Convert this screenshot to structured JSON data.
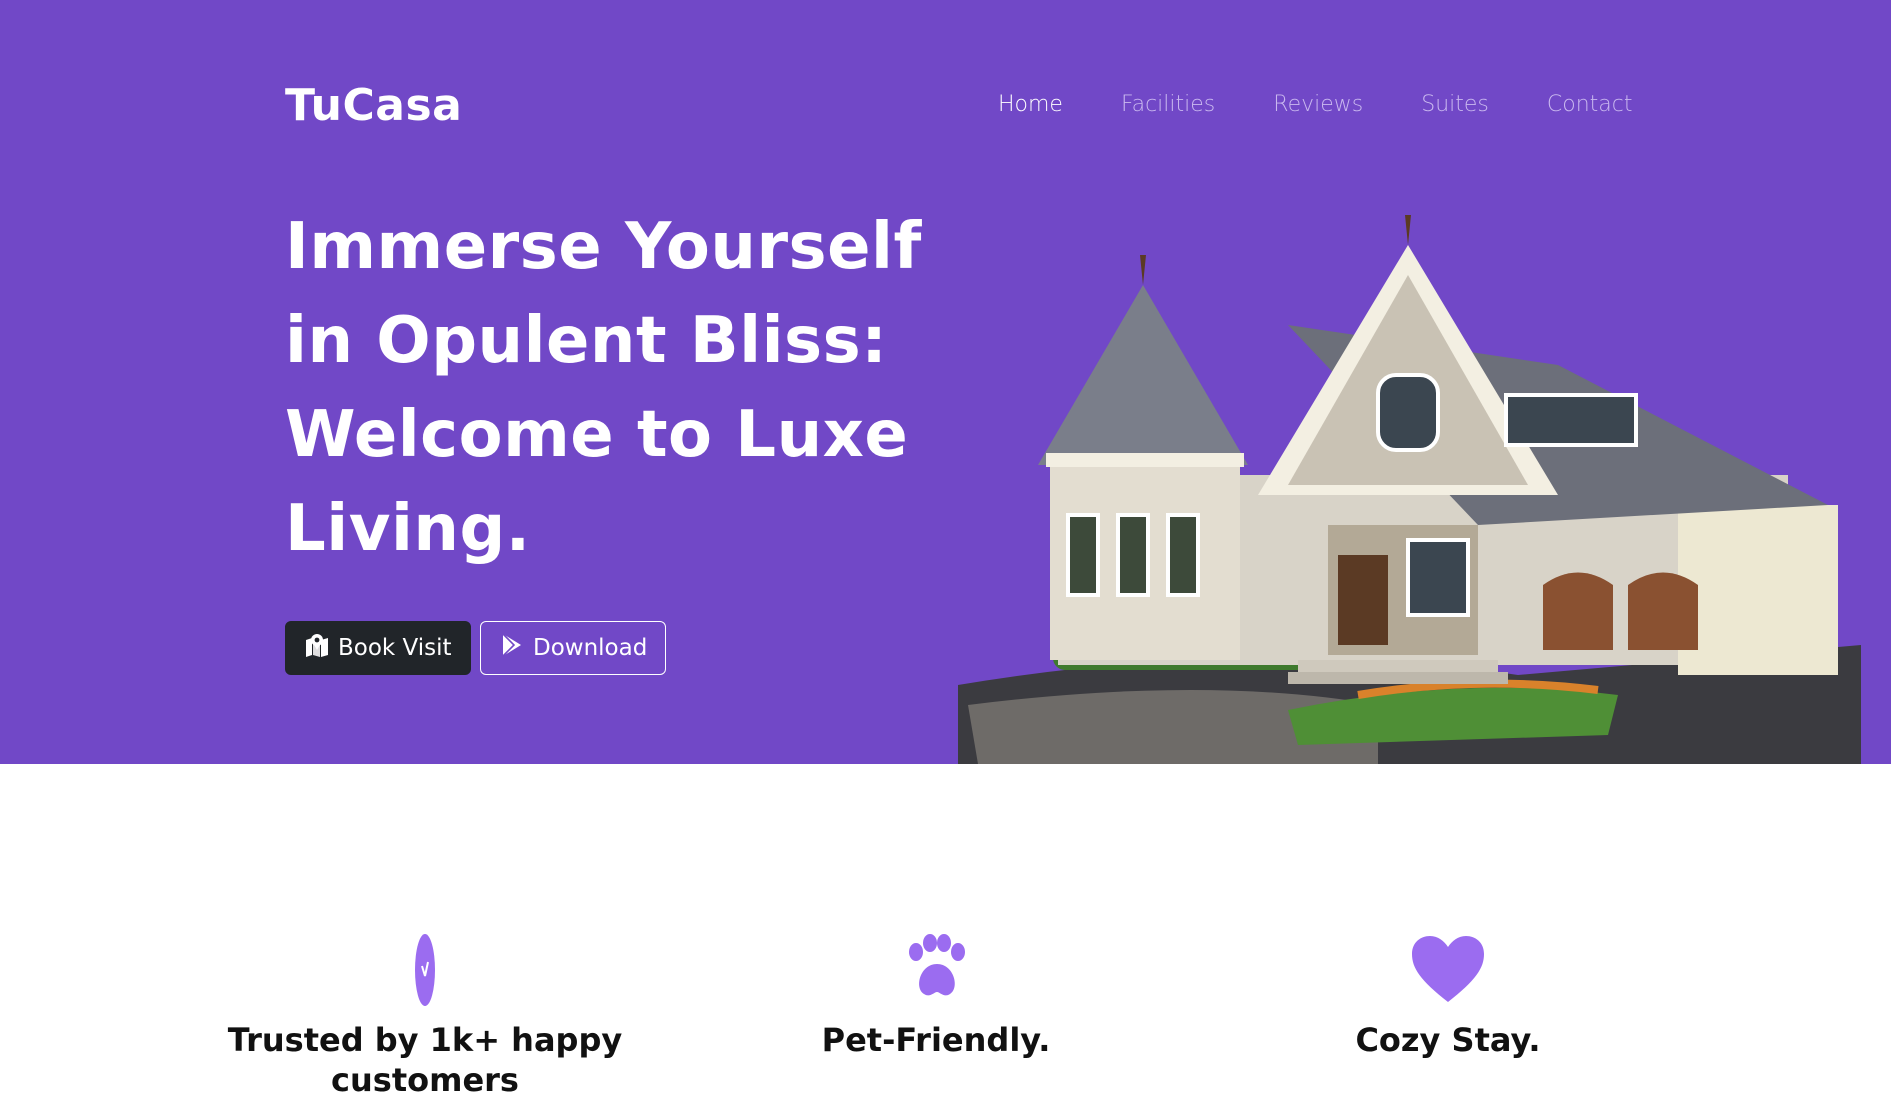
{
  "brand": {
    "name": "TuCasa"
  },
  "nav": {
    "items": [
      "Home",
      "Facilities",
      "Reviews",
      "Suites",
      "Contact"
    ],
    "active": "Home"
  },
  "hero": {
    "headline_lines": [
      "Immerse Yourself",
      "in Opulent Bliss:",
      "Welcome to Luxe",
      "Living."
    ],
    "book_button": {
      "label": "Book Visit",
      "icon": "map-pin-icon"
    },
    "download_button": {
      "label": "Download",
      "icon": "play-store-icon"
    },
    "image": "house-image"
  },
  "features": [
    {
      "title": "Trusted by 1k+ happy customers",
      "icon": "verified-badge-icon"
    },
    {
      "title": "Pet-Friendly.",
      "icon": "paw-icon"
    },
    {
      "title": "Cozy Stay.",
      "icon": "heart-icon"
    }
  ],
  "colors": {
    "hero_bg": "#7148c7",
    "accent": "#9b6cf0",
    "dark_button": "#212529",
    "nav_inactive": "#c9b8ef"
  }
}
